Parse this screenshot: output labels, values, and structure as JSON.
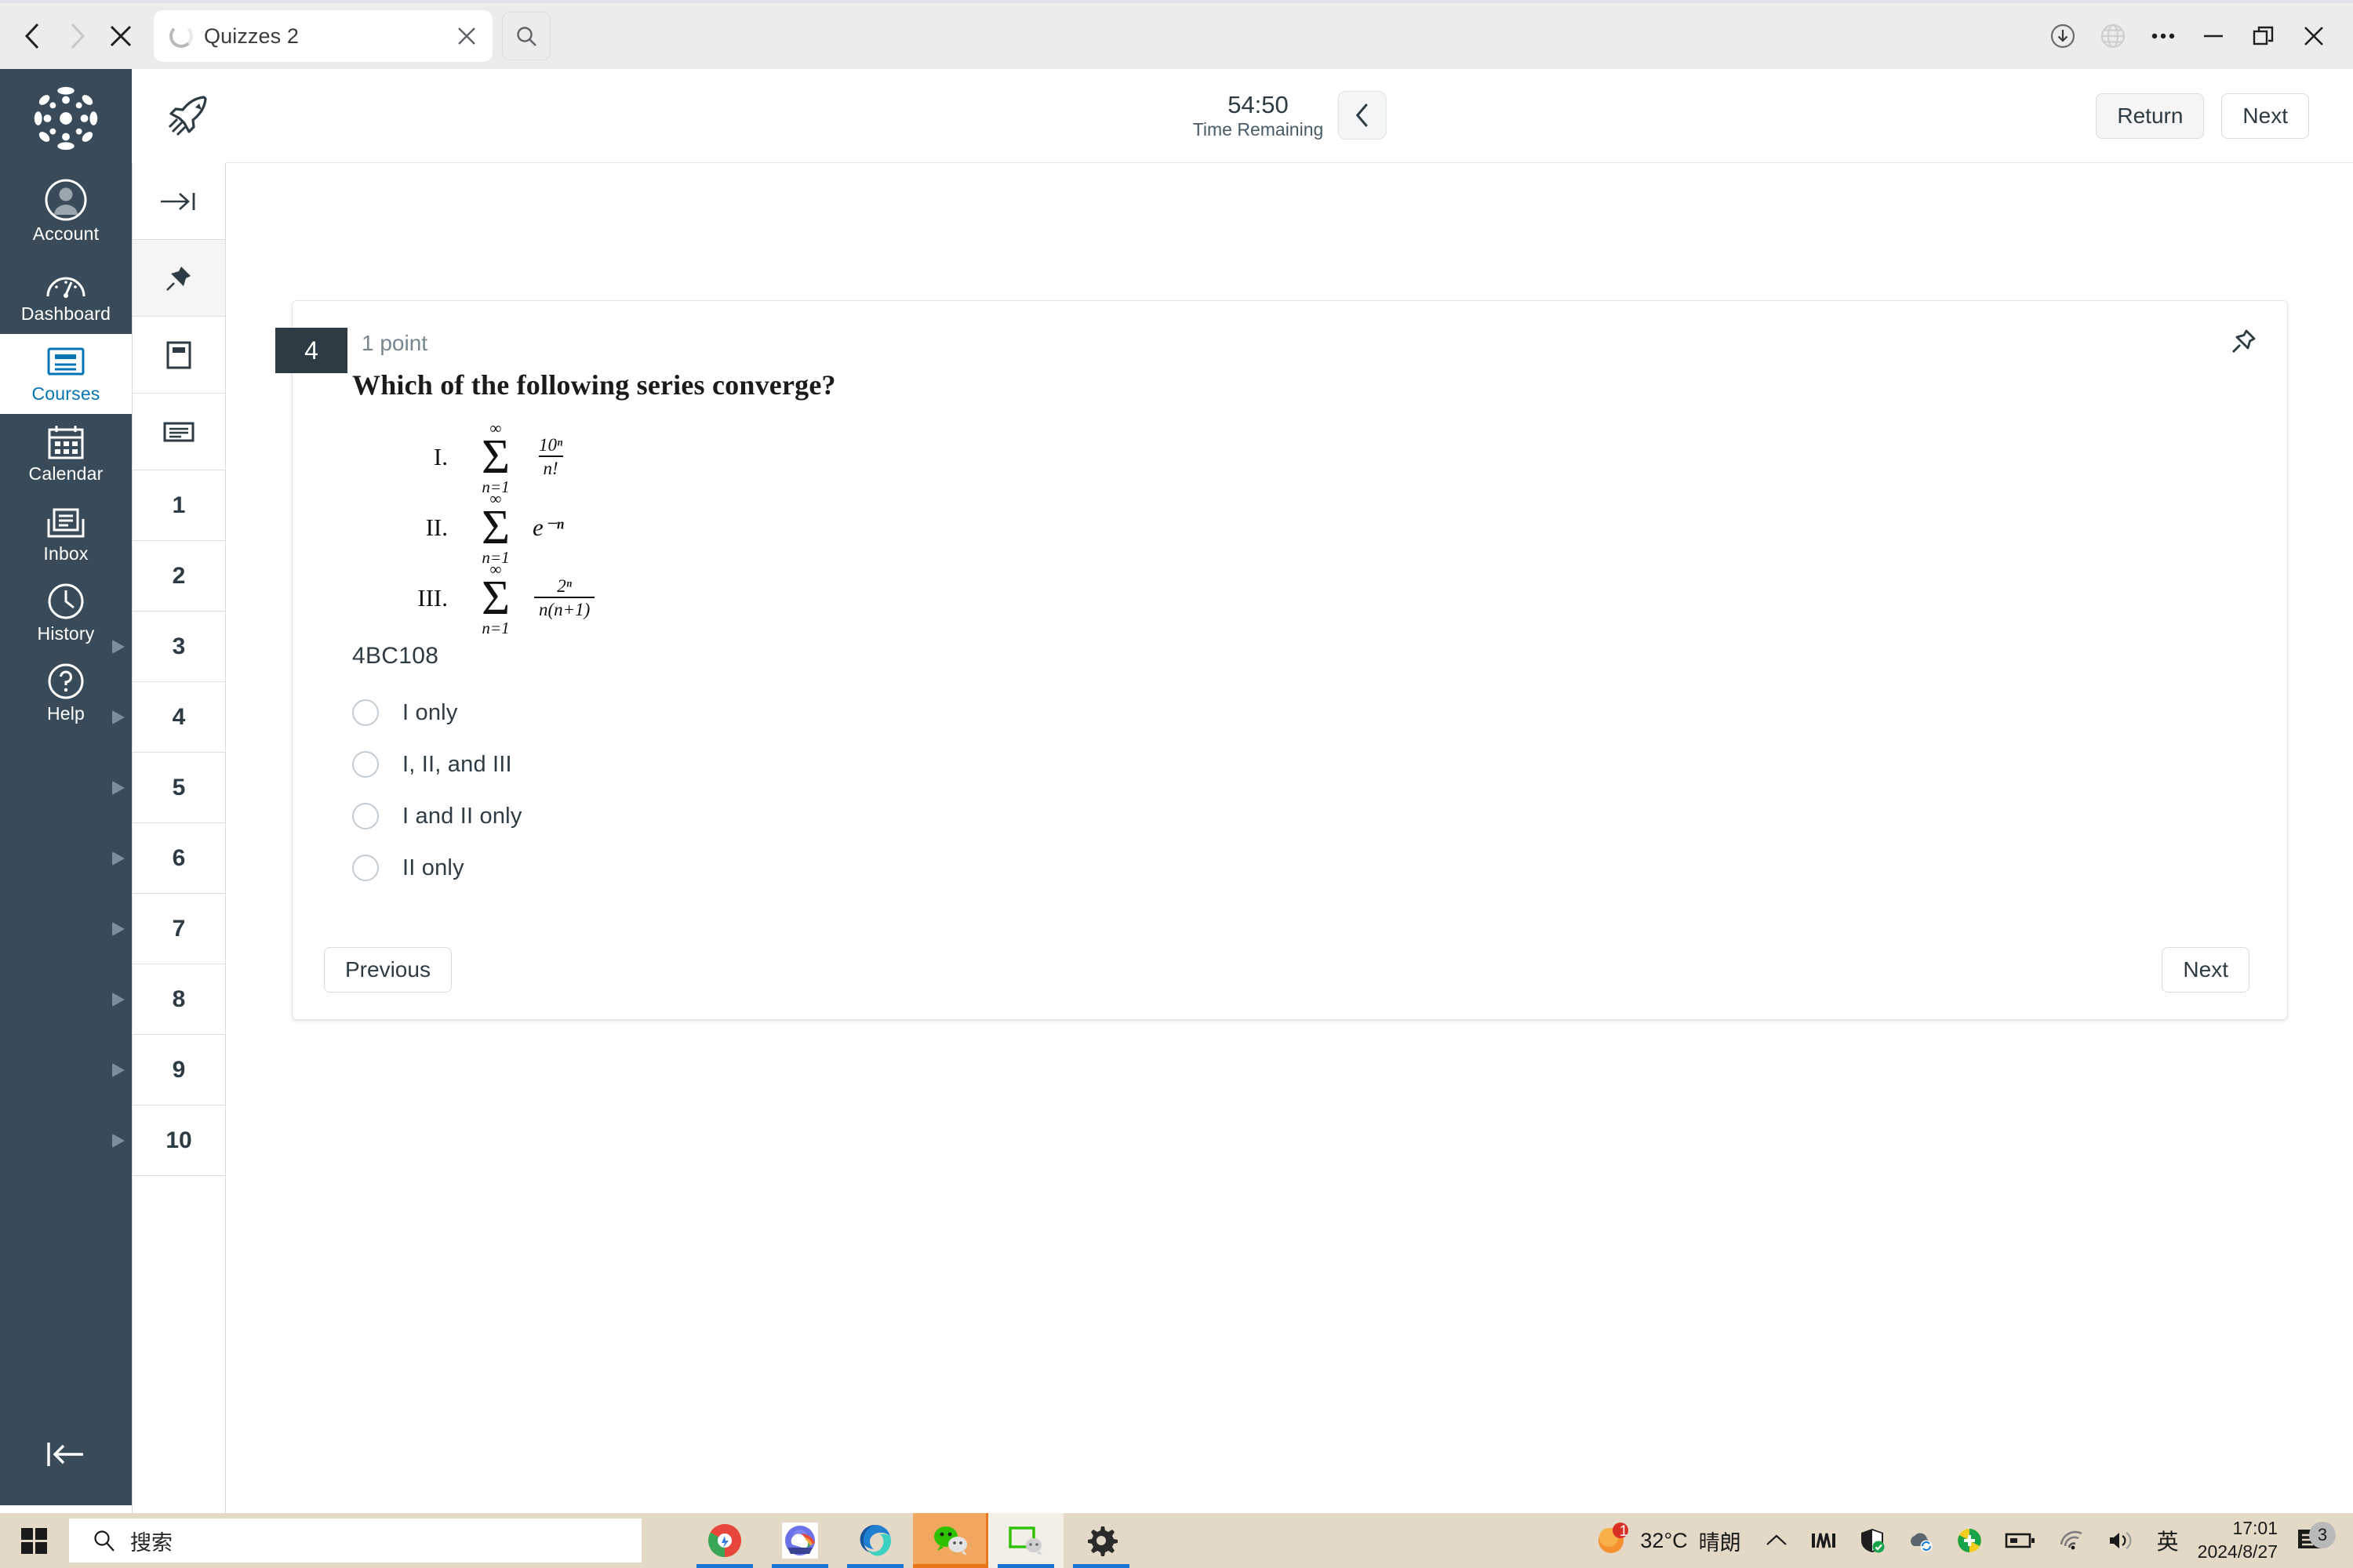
{
  "browser": {
    "nav": {
      "back": "back-arrow",
      "forward": "forward-arrow",
      "stop": "stop-x"
    },
    "tab": {
      "title": "Quizzes 2",
      "close_label": "×",
      "loading": true
    },
    "search_button": "search-icon",
    "window_controls": [
      "download-icon",
      "globe-icon",
      "more-icon",
      "minimize-icon",
      "restore-icon",
      "close-icon"
    ]
  },
  "global_nav": {
    "logo": "canvas-logo",
    "collapse": "collapse-left-icon",
    "items": [
      {
        "label": "Account",
        "icon": "user-avatar-icon",
        "active": false
      },
      {
        "label": "Dashboard",
        "icon": "speedometer-icon",
        "active": false
      },
      {
        "label": "Courses",
        "icon": "book-icon",
        "active": true
      },
      {
        "label": "Calendar",
        "icon": "calendar-icon",
        "active": false
      },
      {
        "label": "Inbox",
        "icon": "inbox-icon",
        "active": false
      },
      {
        "label": "History",
        "icon": "clock-icon",
        "active": false
      },
      {
        "label": "Help",
        "icon": "question-circle-icon",
        "active": false
      }
    ]
  },
  "question_rail": {
    "icon_rows": [
      {
        "icon": "collapse-right-icon",
        "pinned": false
      },
      {
        "icon": "pin-icon",
        "pinned": true
      },
      {
        "icon": "page-icon",
        "pinned": false
      },
      {
        "icon": "list-icon",
        "pinned": false
      }
    ],
    "questions": [
      {
        "number": "1",
        "flag": false
      },
      {
        "number": "2",
        "flag": false
      },
      {
        "number": "3",
        "flag": true
      },
      {
        "number": "4",
        "flag": true
      },
      {
        "number": "5",
        "flag": true
      },
      {
        "number": "6",
        "flag": true
      },
      {
        "number": "7",
        "flag": true
      },
      {
        "number": "8",
        "flag": true
      },
      {
        "number": "9",
        "flag": true
      },
      {
        "number": "10",
        "flag": true
      }
    ]
  },
  "header": {
    "rocket_icon": "rocket-icon",
    "timer_value": "54:50",
    "timer_label": "Time Remaining",
    "collapse_icon": "chevron-left-icon",
    "return_label": "Return",
    "next_label": "Next"
  },
  "question": {
    "number": "4",
    "points": "1 point",
    "pin_icon": "pin-icon",
    "stem": "Which of the following series converge?",
    "math": [
      {
        "roman": "I.",
        "sigma_top": "∞",
        "sigma_bottom": "n=1",
        "kind": "fraction",
        "numerator": "10ⁿ",
        "denominator": "n!"
      },
      {
        "roman": "II.",
        "sigma_top": "∞",
        "sigma_bottom": "n=1",
        "kind": "inline",
        "expression": "e⁻ⁿ"
      },
      {
        "roman": "III.",
        "sigma_top": "∞",
        "sigma_bottom": "n=1",
        "kind": "fraction",
        "numerator": "2ⁿ",
        "denominator": "n(n+1)"
      }
    ],
    "code": "4BC108",
    "options": [
      {
        "label": "I only",
        "selected": false
      },
      {
        "label": "I, II, and III",
        "selected": false
      },
      {
        "label": "I and II only",
        "selected": false
      },
      {
        "label": "II only",
        "selected": false
      }
    ],
    "previous_label": "Previous",
    "next_label": "Next"
  },
  "taskbar": {
    "start_icon": "windows-start-icon",
    "search_placeholder": "搜索",
    "apps": [
      "chrome-icon",
      "cloud-app-icon",
      "edge-icon",
      "wechat-icon",
      "wecom-icon",
      "settings-gear-icon"
    ],
    "weather_temp": "32°C",
    "weather_desc": "晴朗",
    "weather_badge": "1",
    "tray_icons": [
      "chevron-up-icon",
      "network-monitor-icon",
      "defender-shield-icon",
      "sync-cloud-icon",
      "security-plus-icon",
      "battery-icon",
      "wifi-icon",
      "volume-icon"
    ],
    "ime_label": "英",
    "time": "17:01",
    "date": "2024/8/27",
    "notification_count": "3"
  },
  "colors": {
    "canvas_dark": "#394B58",
    "badge_dark": "#2d3b45",
    "active_blue": "#0374B5",
    "taskbar": "#e3d9c6",
    "chrome_bg": "#ececec"
  }
}
